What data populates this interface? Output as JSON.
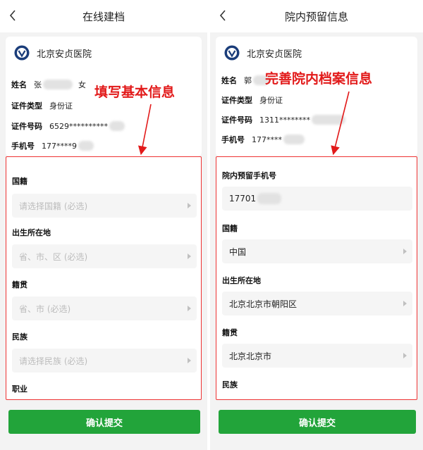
{
  "left": {
    "nav_title": "在线建档",
    "hospital_name": "北京安贞医院",
    "info": {
      "name_label": "姓名",
      "name_value": "张",
      "gender": "女",
      "id_type_label": "证件类型",
      "id_type_value": "身份证",
      "id_no_label": "证件号码",
      "id_no_value": "6529**********",
      "phone_label": "手机号",
      "phone_value": "177****9"
    },
    "fields": [
      {
        "label": "国籍",
        "placeholder": "请选择国籍 (必选)"
      },
      {
        "label": "出生所在地",
        "placeholder": "省、市、区 (必选)"
      },
      {
        "label": "籍贯",
        "placeholder": "省、市 (必选)"
      },
      {
        "label": "民族",
        "placeholder": "请选择民族 (必选)"
      },
      {
        "label": "职业"
      }
    ],
    "submit_label": "确认提交",
    "annotation": "填写基本信息"
  },
  "right": {
    "nav_title": "院内预留信息",
    "hospital_name": "北京安贞医院",
    "info": {
      "name_label": "姓名",
      "name_value": "郭",
      "id_type_label": "证件类型",
      "id_type_value": "身份证",
      "id_no_label": "证件号码",
      "id_no_value": "1311********",
      "phone_label": "手机号",
      "phone_value": "177****"
    },
    "fields": [
      {
        "label": "院内预留手机号",
        "value": "17701"
      },
      {
        "label": "国籍",
        "value": "中国"
      },
      {
        "label": "出生所在地",
        "value": "北京北京市朝阳区"
      },
      {
        "label": "籍贯",
        "value": "北京北京市"
      },
      {
        "label": "民族"
      }
    ],
    "submit_label": "确认提交",
    "annotation": "完善院内档案信息"
  },
  "colors": {
    "accent_green": "#22a43a",
    "annotation_red": "#e21a1a",
    "hospital_logo": "#1b3d7a"
  },
  "icons": [
    "back-chevron-icon",
    "hospital-logo-icon",
    "chevron-right-icon"
  ]
}
